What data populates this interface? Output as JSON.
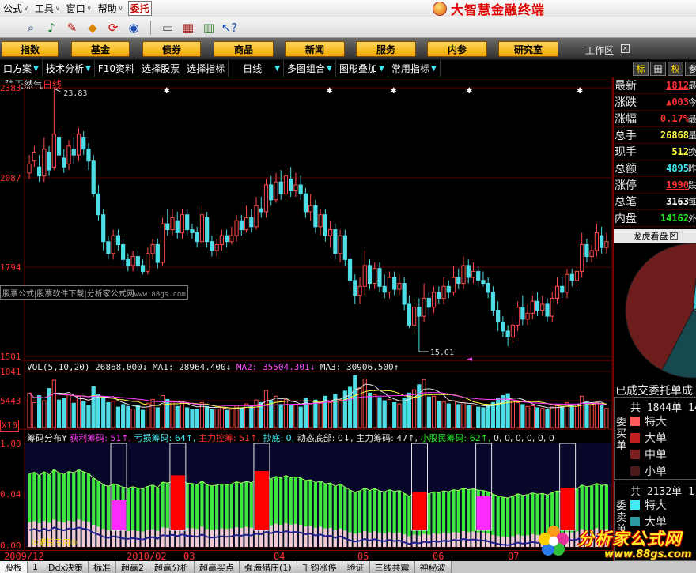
{
  "menu": {
    "items": [
      {
        "label": "公式",
        "arrow": "∨"
      },
      {
        "label": "工具",
        "arrow": "∨"
      },
      {
        "label": "窗口",
        "arrow": "∨"
      },
      {
        "label": "帮助",
        "arrow": "∨"
      }
    ],
    "entrust_label": "委托",
    "brand": "大智慧金融终端"
  },
  "toolbar": {
    "icons": [
      {
        "name": "binoculars-icon",
        "glyph": "⌕",
        "color": "#0b3a7e"
      },
      {
        "name": "alarm-bell-icon",
        "glyph": "♪",
        "color": "#0a7a2a"
      },
      {
        "name": "pen-chart-icon",
        "glyph": "✎",
        "color": "#c00000"
      },
      {
        "name": "diamond-icon",
        "glyph": "◆",
        "color": "#d88400"
      },
      {
        "name": "sync-icon",
        "glyph": "⟳",
        "color": "#d00000"
      },
      {
        "name": "network-icon",
        "glyph": "◉",
        "color": "#1a4fb8"
      },
      {
        "name": "copy-window-icon",
        "glyph": "▭",
        "color": "#4a4a4a"
      },
      {
        "name": "layout-icon",
        "glyph": "▦",
        "color": "#9c1010"
      },
      {
        "name": "books-icon",
        "glyph": "▥",
        "color": "#2f7a2f"
      },
      {
        "name": "help-cursor-icon",
        "glyph": "↖?",
        "color": "#1a4fb8"
      }
    ]
  },
  "nav": {
    "buttons": [
      "指数",
      "基金",
      "债券",
      "商品",
      "新闻",
      "服务",
      "内参",
      "研究室"
    ],
    "workspace": "工作区",
    "workspace_close": "✕"
  },
  "funcbar": {
    "items": [
      "口方案",
      "技术分析",
      "F10资料",
      "选择股票",
      "选择指标",
      "日线",
      "多图组合",
      "图形叠加",
      "常用指标"
    ],
    "right_buttons": [
      "标",
      "田",
      "权",
      "参"
    ]
  },
  "chart": {
    "stock_name": "陕天然气",
    "period": "日线",
    "high_label": "23.83",
    "low_label": "15.01",
    "watermark_a": "股票公式|股票软件下载|分析家公式网",
    "watermark_b": "www.88gs.com",
    "price_axis": [
      "2383",
      "2087",
      "1794",
      "1501"
    ],
    "vol_axis": [
      "1041",
      "5443",
      "X10"
    ],
    "chip_axis": [
      "1.00",
      "0.04",
      "0.00"
    ],
    "vol_legend": [
      {
        "text": "VOL(5,10,20) ",
        "color": "#e6e6e6"
      },
      {
        "text": "26868.000↓",
        "color": "#e6e6e6"
      },
      {
        "text": " MA1: ",
        "color": "#e6e6e6"
      },
      {
        "text": "28964.400↓",
        "color": "#e6e6e6"
      },
      {
        "text": " MA2: ",
        "color": "#ff4fff"
      },
      {
        "text": "35504.301↓",
        "color": "#ff4fff"
      },
      {
        "text": " MA3: ",
        "color": "#e6e6e6"
      },
      {
        "text": "30906.500↑",
        "color": "#e6e6e6"
      }
    ],
    "chip_legend": [
      {
        "text": "筹码分布Y ",
        "color": "#e6e6e6"
      },
      {
        "text": "获利筹码: 51↑, ",
        "color": "#ff3cff"
      },
      {
        "text": "亏损筹码: 64↑, ",
        "color": "#44e8f2"
      },
      {
        "text": "主力控筹: 51↑, ",
        "color": "#ff3030"
      },
      {
        "text": "抄底: 0, ",
        "color": "#44e8f2"
      },
      {
        "text": "动态底部: 0↓, ",
        "color": "#e6e6e6"
      },
      {
        "text": "主力筹码: 47↑, ",
        "color": "#e6e6e6"
      },
      {
        "text": "小股民筹码: 62↑, ",
        "color": "#22ee22"
      },
      {
        "text": "0, 0, 0, 0, 0, 0",
        "color": "#e6e6e6"
      }
    ],
    "hist_tag": "⑤老民专用⑤",
    "dates": [
      "2009/12",
      "2010/02",
      "03",
      "04",
      "05",
      "06",
      "07"
    ],
    "arrow_glyph": "◄"
  },
  "chart_data": {
    "type": "candlestick",
    "ylim": [
      15.01,
      23.83
    ],
    "x_dates": [
      "2009/12",
      "2010/02",
      "03",
      "04",
      "05",
      "06",
      "07"
    ],
    "candles": [
      [
        21.0,
        21.3,
        21.6,
        20.8
      ],
      [
        21.4,
        21.7,
        21.9,
        21.2
      ],
      [
        21.2,
        20.9,
        21.6,
        20.7
      ],
      [
        20.9,
        21.8,
        22.2,
        20.7
      ],
      [
        21.7,
        21.1,
        21.9,
        20.9
      ],
      [
        21.2,
        22.3,
        23.83,
        21.1
      ],
      [
        22.2,
        21.6,
        22.4,
        21.4
      ],
      [
        21.5,
        21.2,
        21.8,
        21.0
      ],
      [
        21.3,
        21.9,
        22.1,
        21.1
      ],
      [
        21.8,
        21.6,
        22.2,
        21.3
      ],
      [
        21.6,
        22.3,
        22.5,
        21.4
      ],
      [
        22.2,
        21.8,
        22.4,
        21.6
      ],
      [
        21.8,
        21.4,
        22.0,
        21.1
      ],
      [
        21.4,
        20.3,
        21.6,
        20.2
      ],
      [
        20.3,
        19.6,
        20.6,
        19.4
      ],
      [
        19.6,
        18.7,
        19.8,
        18.4
      ],
      [
        18.7,
        18.3,
        18.9,
        18.1
      ],
      [
        18.3,
        18.9,
        19.1,
        18.1
      ],
      [
        18.9,
        18.6,
        19.1,
        18.4
      ],
      [
        18.6,
        18.1,
        18.8,
        17.9
      ],
      [
        18.1,
        17.9,
        18.3,
        17.7
      ],
      [
        17.9,
        18.2,
        18.4,
        17.7
      ],
      [
        18.2,
        17.9,
        18.4,
        17.7
      ],
      [
        17.9,
        17.7,
        18.1,
        17.6
      ],
      [
        17.7,
        18.3,
        18.5,
        17.6
      ],
      [
        18.3,
        18.6,
        18.8,
        18.1
      ],
      [
        18.6,
        18.0,
        18.8,
        17.8
      ],
      [
        18.0,
        19.3,
        19.5,
        17.9
      ],
      [
        19.3,
        19.1,
        19.8,
        18.9
      ],
      [
        19.1,
        19.5,
        19.8,
        18.9
      ],
      [
        19.4,
        19.0,
        19.7,
        18.8
      ],
      [
        19.0,
        19.6,
        19.8,
        18.8
      ],
      [
        19.6,
        19.1,
        19.8,
        18.9
      ],
      [
        19.1,
        19.0,
        19.3,
        18.8
      ],
      [
        19.0,
        18.7,
        19.2,
        18.5
      ],
      [
        18.7,
        19.6,
        19.9,
        18.6
      ],
      [
        19.5,
        18.7,
        19.7,
        18.5
      ],
      [
        18.7,
        18.4,
        18.9,
        18.2
      ],
      [
        18.4,
        18.6,
        18.8,
        18.2
      ],
      [
        18.6,
        18.9,
        19.1,
        18.4
      ],
      [
        18.9,
        18.7,
        19.1,
        18.5
      ],
      [
        18.7,
        18.9,
        19.2,
        18.6
      ],
      [
        18.9,
        19.4,
        19.6,
        18.7
      ],
      [
        19.4,
        19.1,
        19.6,
        18.9
      ],
      [
        19.1,
        19.5,
        19.9,
        19.0
      ],
      [
        19.5,
        19.2,
        19.8,
        19.0
      ],
      [
        19.2,
        19.9,
        20.2,
        19.1
      ],
      [
        19.8,
        19.7,
        20.2,
        19.5
      ],
      [
        19.7,
        20.6,
        20.8,
        19.5
      ],
      [
        20.6,
        20.1,
        20.9,
        19.9
      ],
      [
        20.1,
        20.7,
        21.0,
        20.0
      ],
      [
        20.7,
        20.3,
        21.1,
        20.1
      ],
      [
        20.3,
        20.9,
        21.1,
        20.1
      ],
      [
        20.8,
        20.4,
        21.2,
        20.2
      ],
      [
        20.4,
        20.6,
        21.0,
        20.2
      ],
      [
        20.6,
        20.3,
        20.9,
        20.1
      ],
      [
        20.3,
        19.7,
        20.5,
        19.5
      ],
      [
        19.7,
        19.9,
        20.3,
        19.4
      ],
      [
        19.9,
        19.2,
        20.1,
        19.0
      ],
      [
        19.2,
        19.6,
        19.8,
        18.9
      ],
      [
        19.6,
        18.9,
        19.8,
        18.7
      ],
      [
        18.9,
        19.1,
        19.4,
        18.5
      ],
      [
        19.1,
        18.3,
        19.3,
        18.1
      ],
      [
        18.3,
        18.9,
        19.1,
        18.0
      ],
      [
        18.9,
        18.1,
        19.1,
        17.9
      ],
      [
        18.1,
        17.4,
        18.3,
        17.2
      ],
      [
        17.4,
        16.9,
        17.6,
        16.6
      ],
      [
        16.9,
        17.2,
        17.5,
        16.6
      ],
      [
        17.2,
        17.9,
        18.4,
        16.9
      ],
      [
        17.9,
        17.3,
        18.1,
        17.1
      ],
      [
        17.3,
        17.8,
        18.0,
        17.1
      ],
      [
        17.8,
        17.2,
        18.0,
        17.0
      ],
      [
        17.2,
        17.0,
        17.6,
        16.8
      ],
      [
        17.0,
        17.5,
        17.7,
        16.8
      ],
      [
        17.5,
        17.1,
        17.7,
        16.9
      ],
      [
        17.1,
        17.3,
        17.6,
        16.9
      ],
      [
        17.3,
        16.6,
        17.5,
        16.4
      ],
      [
        16.6,
        15.9,
        16.9,
        15.8
      ],
      [
        15.9,
        16.5,
        16.8,
        15.6
      ],
      [
        16.5,
        16.2,
        16.8,
        15.01
      ],
      [
        16.2,
        16.8,
        17.3,
        16.0
      ],
      [
        16.8,
        16.5,
        17.0,
        16.2
      ],
      [
        16.5,
        17.0,
        17.2,
        16.3
      ],
      [
        17.0,
        16.8,
        17.2,
        16.6
      ],
      [
        16.8,
        17.2,
        17.5,
        16.6
      ],
      [
        17.2,
        17.0,
        17.4,
        16.8
      ],
      [
        17.0,
        17.5,
        17.9,
        16.9
      ],
      [
        17.5,
        17.3,
        17.8,
        17.1
      ],
      [
        17.3,
        17.9,
        18.2,
        17.1
      ],
      [
        17.9,
        17.5,
        18.1,
        17.3
      ],
      [
        17.5,
        17.7,
        18.0,
        17.3
      ],
      [
        17.7,
        17.4,
        17.9,
        17.2
      ],
      [
        17.4,
        17.3,
        17.7,
        17.2
      ],
      [
        17.3,
        17.0,
        17.5,
        16.8
      ],
      [
        17.0,
        16.4,
        17.2,
        16.2
      ],
      [
        16.4,
        16.0,
        16.7,
        15.7
      ],
      [
        16.0,
        15.7,
        16.2,
        15.5
      ],
      [
        15.7,
        15.5,
        15.9,
        15.2
      ],
      [
        15.5,
        15.9,
        16.2,
        15.3
      ],
      [
        15.9,
        16.5,
        16.7,
        15.7
      ],
      [
        16.5,
        16.1,
        16.9,
        15.9
      ],
      [
        16.1,
        16.3,
        16.6,
        15.9
      ],
      [
        16.3,
        16.7,
        16.9,
        16.1
      ],
      [
        16.7,
        16.4,
        17.0,
        16.2
      ],
      [
        16.4,
        16.6,
        16.9,
        16.2
      ],
      [
        16.6,
        16.2,
        16.8,
        16.0
      ],
      [
        16.2,
        16.8,
        17.0,
        16.0
      ],
      [
        16.8,
        17.2,
        17.5,
        16.6
      ],
      [
        17.2,
        17.0,
        17.5,
        16.8
      ],
      [
        17.0,
        17.6,
        17.8,
        16.8
      ],
      [
        17.6,
        17.4,
        17.8,
        17.2
      ],
      [
        17.4,
        17.7,
        17.9,
        17.2
      ],
      [
        17.7,
        18.6,
        19.0,
        17.5
      ],
      [
        18.6,
        18.2,
        18.8,
        18.0
      ],
      [
        18.2,
        18.4,
        18.6,
        18.0
      ],
      [
        18.4,
        19.0,
        19.3,
        18.2
      ],
      [
        18.9,
        18.5,
        19.2,
        18.3
      ],
      [
        18.5,
        18.7,
        19.0,
        18.3
      ]
    ],
    "volume": [
      5.4,
      3.9,
      5.0,
      4.2,
      6.1,
      7.4,
      4.3,
      4.6,
      5.1,
      3.8,
      4.9,
      4.1,
      3.5,
      6.4,
      5.2,
      4.7,
      3.9,
      4.1,
      3.2,
      3.6,
      3.3,
      2.9,
      3.4,
      2.7,
      3.8,
      4.4,
      3.1,
      5.0,
      4.4,
      4.0,
      3.3,
      4.0,
      3.1,
      2.8,
      2.9,
      3.9,
      3.3,
      2.8,
      2.9,
      3.1,
      2.7,
      2.9,
      3.5,
      3.0,
      3.7,
      3.2,
      4.3,
      3.9,
      5.8,
      4.2,
      4.9,
      3.6,
      4.4,
      3.5,
      3.6,
      3.2,
      4.6,
      3.7,
      4.3,
      3.8,
      4.9,
      3.9,
      5.2,
      4.3,
      5.7,
      6.3,
      8.1,
      6.2,
      7.6,
      5.4,
      5.1,
      4.7,
      4.2,
      4.4,
      3.9,
      3.7,
      4.6,
      5.4,
      5.9,
      6.7,
      7.5,
      4.8,
      4.9,
      4.1,
      4.0,
      3.7,
      4.2,
      3.6,
      3.9,
      3.5,
      3.5,
      3.2,
      3.1,
      3.4,
      3.9,
      4.6,
      5.0,
      5.3,
      4.2,
      3.9,
      3.6,
      3.3,
      3.4,
      3.1,
      3.0,
      2.8,
      3.2,
      3.6,
      3.3,
      3.9,
      3.4,
      3.5,
      4.9,
      4.1,
      3.5,
      3.9,
      3.4,
      3.0
    ],
    "chip": {
      "profit": 51,
      "loss": 64,
      "main_control": 51,
      "bottom": 0,
      "dynamic_bottom": 0,
      "main_chips": 47,
      "retail_chips": 62
    },
    "pie": [
      {
        "label": "slice-1",
        "value": 0.16,
        "color": "#37c4cc"
      },
      {
        "label": "slice-2",
        "value": 0.12,
        "color": "#2b8f96"
      },
      {
        "label": "slice-3",
        "value": 0.28,
        "color": "#174a50"
      },
      {
        "label": "slice-4",
        "value": 0.44,
        "color": "#6e1d1d"
      }
    ]
  },
  "quote": {
    "rows": [
      {
        "label": "最新",
        "value": "1812",
        "color": "#ff3030",
        "underline": true,
        "ext": "最"
      },
      {
        "label": "涨跌",
        "value": "▲003",
        "color": "#ff3030",
        "underline": false,
        "ext": "今"
      },
      {
        "label": "涨幅",
        "value": "0.17%",
        "color": "#ff3030",
        "underline": false,
        "ext": "最"
      },
      {
        "label": "总手",
        "value": "26868",
        "color": "#ffff40",
        "underline": false,
        "ext": "量"
      },
      {
        "label": "现手",
        "value": "512",
        "color": "#ffff40",
        "underline": false,
        "ext": "换"
      },
      {
        "label": "总额",
        "value": "4895",
        "color": "#44e8f2",
        "underline": false,
        "ext": "昨"
      },
      {
        "label": "涨停",
        "value": "1990",
        "color": "#ff3030",
        "underline": true,
        "ext": "跌"
      },
      {
        "label": "总笔",
        "value": "3163",
        "color": "#ffffff",
        "underline": false,
        "ext": "每"
      },
      {
        "label": "内盘",
        "value": "14162",
        "color": "#22ee22",
        "underline": false,
        "ext": "外"
      }
    ],
    "lh_title": "龙虎看盘",
    "lh_close": "✕",
    "order_title": "已成交委托单成",
    "buy_side": "委买单",
    "sell_side": "委卖单",
    "buy_head": "共 1844单 14",
    "sell_head": "共 2132单 1",
    "buy_rows": [
      {
        "label": "特大",
        "color": "#ff5a5a"
      },
      {
        "label": "大单",
        "color": "#c02020"
      },
      {
        "label": "中单",
        "color": "#7a2020"
      },
      {
        "label": "小单",
        "color": "#4a1a1a"
      }
    ],
    "sell_rows": [
      {
        "label": "特大",
        "color": "#44e8f2"
      },
      {
        "label": "大单",
        "color": "#2b9aa0"
      }
    ]
  },
  "tabs": [
    "股板",
    "1",
    "Ddx决策",
    "标准",
    "超赢2",
    "超赢分析",
    "超赢买点",
    "强海猎庄(1)",
    "千钧涨停",
    "验证",
    "三线共震",
    "神秘波"
  ],
  "logo": {
    "main": "分析家公式网",
    "url": "www.88gs.com"
  }
}
